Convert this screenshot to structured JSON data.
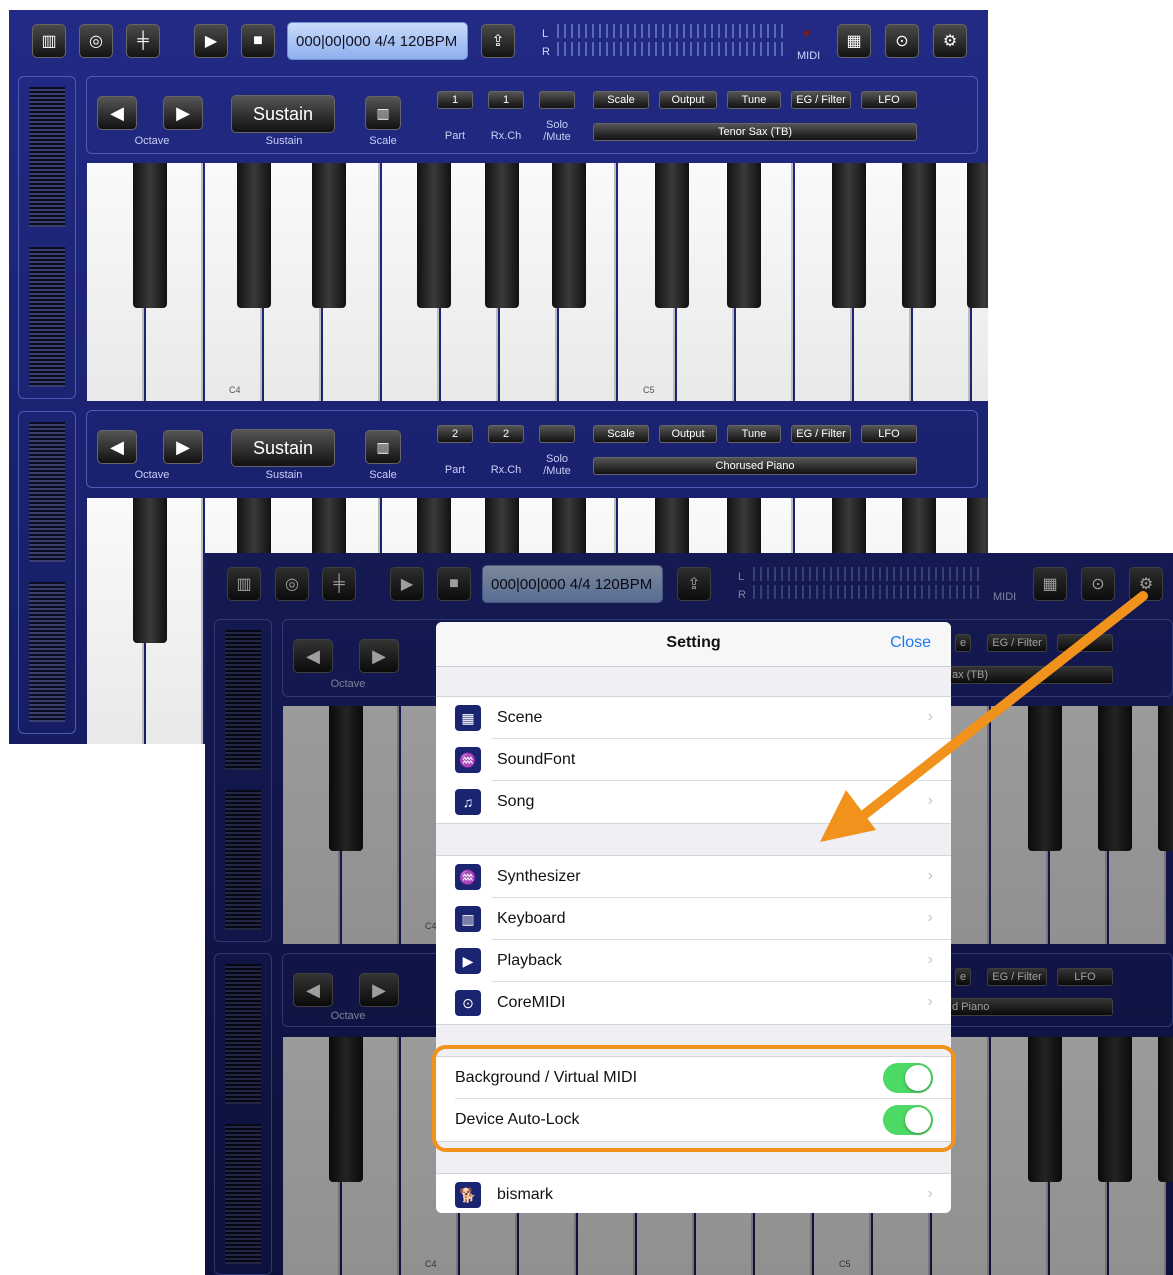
{
  "toolbar": {
    "transport_display": "000|00|000 4/4 120BPM",
    "meter_left": "L",
    "meter_right": "R",
    "midi_label": "MIDI"
  },
  "part1": {
    "sustain_label": "Sustain",
    "octave_label": "Octave",
    "sustain_caption": "Sustain",
    "scale_caption": "Scale",
    "part_value": "1",
    "rxch_value": "1",
    "part_caption": "Part",
    "rxch_caption": "Rx.Ch",
    "solo_caption": "Solo /Mute",
    "tabs": [
      "Scale",
      "Output",
      "Tune",
      "EG / Filter",
      "LFO"
    ],
    "instrument": "Tenor Sax (TB)",
    "note_c4": "C4",
    "note_c5": "C5"
  },
  "part2": {
    "sustain_label": "Sustain",
    "octave_label": "Octave",
    "sustain_caption": "Sustain",
    "scale_caption": "Scale",
    "part_value": "2",
    "rxch_value": "2",
    "part_caption": "Part",
    "rxch_caption": "Rx.Ch",
    "solo_caption": "Solo /Mute",
    "tabs": [
      "Scale",
      "Output",
      "Tune",
      "EG / Filter",
      "LFO"
    ],
    "instrument": "Chorused Piano"
  },
  "front": {
    "transport_display": "000|00|000 4/4 120BPM",
    "meter_left": "L",
    "meter_right": "R",
    "midi_label": "MIDI",
    "octave_label": "Octave",
    "tab_eg_filter": "EG / Filter",
    "tab_lfo": "LFO",
    "instrument_partial_1": "ax (TB)",
    "instrument_partial_2": "d Piano",
    "note_c4": "C4",
    "note_c5": "C5",
    "tab_partial": "e"
  },
  "settings": {
    "title": "Setting",
    "close": "Close",
    "group1": [
      {
        "icon": "scene-icon",
        "label": "Scene",
        "chevron": true
      },
      {
        "icon": "soundfont-icon",
        "label": "SoundFont",
        "chevron": false
      },
      {
        "icon": "song-icon",
        "label": "Song",
        "chevron": true
      }
    ],
    "group2": [
      {
        "icon": "synthesizer-icon",
        "label": "Synthesizer",
        "chevron": true
      },
      {
        "icon": "keyboard-icon",
        "label": "Keyboard",
        "chevron": true
      },
      {
        "icon": "playback-icon",
        "label": "Playback",
        "chevron": true
      },
      {
        "icon": "coremidi-icon",
        "label": "CoreMIDI",
        "chevron": true
      }
    ],
    "toggles": [
      {
        "label": "Background / Virtual MIDI",
        "on": true
      },
      {
        "label": "Device Auto-Lock",
        "on": true
      }
    ],
    "footer_item": {
      "icon": "dog-icon",
      "label": "bismark"
    }
  },
  "colors": {
    "app_bg": "#1b2270",
    "toggle_on": "#4cd964",
    "close_link": "#1a7bf0",
    "highlight": "#f0921c",
    "arrow": "#f0921c"
  }
}
